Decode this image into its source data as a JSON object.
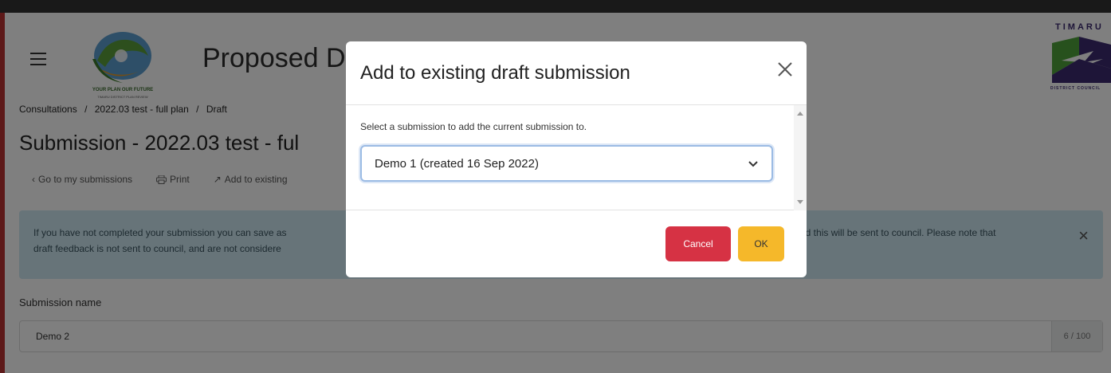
{
  "header": {
    "app_title": "Proposed D",
    "logo_text": "YOUR PLAN OUR FUTURE",
    "logo_subtext": "TIMARU DISTRICT PLAN REVIEW",
    "council_name_top": "TIMARU",
    "council_name_bottom": "DISTRICT COUNCIL"
  },
  "breadcrumb": {
    "items": [
      "Consultations",
      "2022.03 test - full plan",
      "Draft"
    ],
    "separator": "/"
  },
  "page": {
    "heading": "Submission - 2022.03 test - ful",
    "actions": {
      "back_label": "Go to my submissions",
      "print_label": "Print",
      "add_existing_label": "Add to existing"
    }
  },
  "info_banner": {
    "line1": "If you have not completed your submission you can save as",
    "line2": "draft feedback is not sent to council, and are not considere",
    "line1_right": "nd this will be sent to council. Please note that"
  },
  "submission_name": {
    "label": "Submission name",
    "value": "Demo 2",
    "counter": "6 / 100"
  },
  "modal": {
    "title": "Add to existing draft submission",
    "prompt": "Select a submission to add the current submission to.",
    "selected_option": "Demo 1 (created 16 Sep 2022)",
    "cancel_label": "Cancel",
    "ok_label": "OK"
  },
  "colors": {
    "cancel": "#d63244",
    "ok": "#f5b82a",
    "banner": "#cfe8f2",
    "select_focus": "#9bbbe4"
  }
}
